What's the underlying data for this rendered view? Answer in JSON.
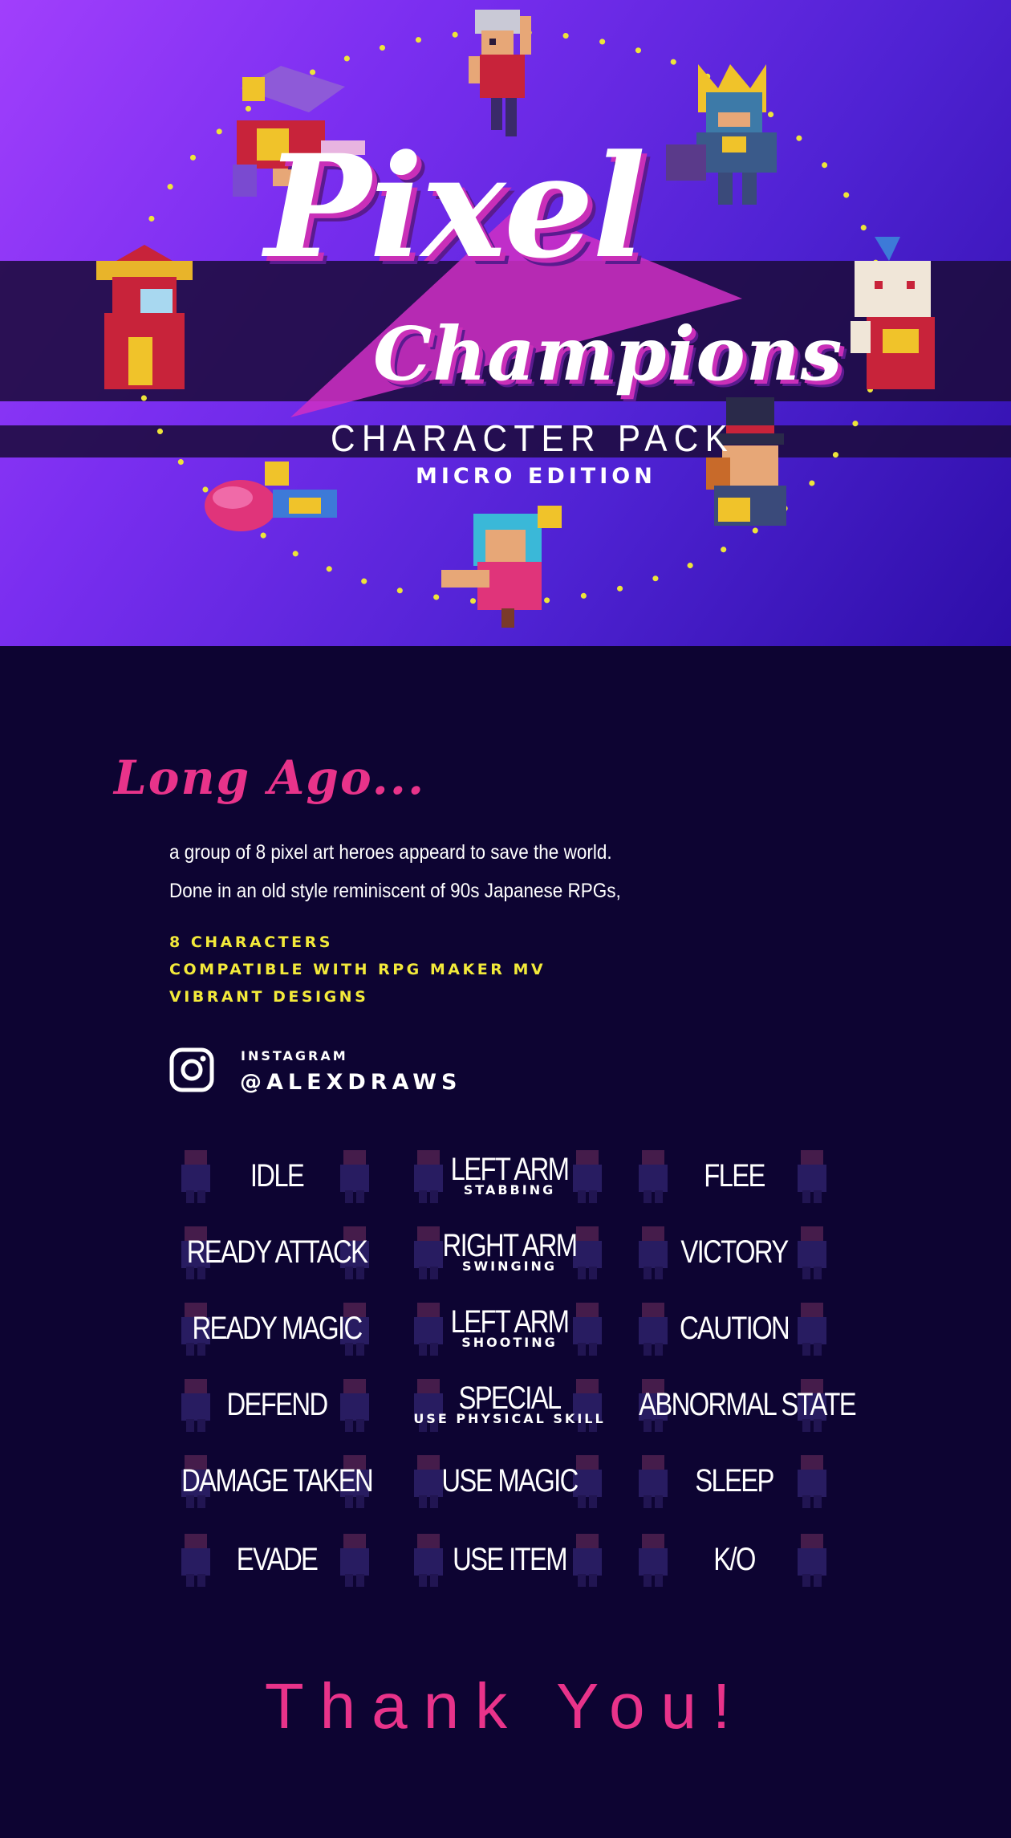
{
  "hero": {
    "title_line1": "Pixel",
    "title_line2": "Champions",
    "subtitle": "CHARACTER PACK",
    "edition": "MICRO EDITION",
    "characters": [
      {
        "name": "silver-haired-fighter-sprite"
      },
      {
        "name": "purple-jester-sprite"
      },
      {
        "name": "horned-knight-sprite"
      },
      {
        "name": "red-mage-sprite"
      },
      {
        "name": "goat-monk-sprite"
      },
      {
        "name": "pink-dancer-sprite"
      },
      {
        "name": "top-hat-gentleman-sprite"
      },
      {
        "name": "teal-haired-girl-sprite"
      }
    ]
  },
  "info": {
    "heading": "Long Ago...",
    "description_line1": "a group of 8 pixel art heroes appeard to save the world.",
    "description_line2": "Done in an old style reminiscent of 90s Japanese RPGs,",
    "features": [
      "8 CHARACTERS",
      "COMPATIBLE WITH RPG MAKER MV",
      "VIBRANT DESIGNS"
    ]
  },
  "social": {
    "label": "INSTAGRAM",
    "handle": "@ALEXDRAWS",
    "icon": "instagram-icon"
  },
  "actions": [
    [
      {
        "label": "IDLE"
      },
      {
        "label": "LEFT ARM",
        "sub": "STABBING"
      },
      {
        "label": "FLEE"
      }
    ],
    [
      {
        "label": "READY ATTACK"
      },
      {
        "label": "RIGHT ARM",
        "sub": "SWINGING"
      },
      {
        "label": "VICTORY"
      }
    ],
    [
      {
        "label": "READY MAGIC"
      },
      {
        "label": "LEFT ARM",
        "sub": "SHOOTING"
      },
      {
        "label": "CAUTION"
      }
    ],
    [
      {
        "label": "DEFEND"
      },
      {
        "label": "SPECIAL",
        "sub": "USE PHYSICAL SKILL"
      },
      {
        "label": "ABNORMAL STATE"
      }
    ],
    [
      {
        "label": "DAMAGE TAKEN"
      },
      {
        "label": "USE MAGIC"
      },
      {
        "label": "SLEEP"
      }
    ],
    [
      {
        "label": "EVADE"
      },
      {
        "label": "USE ITEM"
      },
      {
        "label": "K/O"
      }
    ]
  ],
  "footer": {
    "thanks": "Thank You!"
  },
  "colors": {
    "background": "#0d0432",
    "accent_pink": "#e8338a",
    "accent_yellow": "#f3ea3a",
    "hero_purple": "#7a2ef0"
  }
}
